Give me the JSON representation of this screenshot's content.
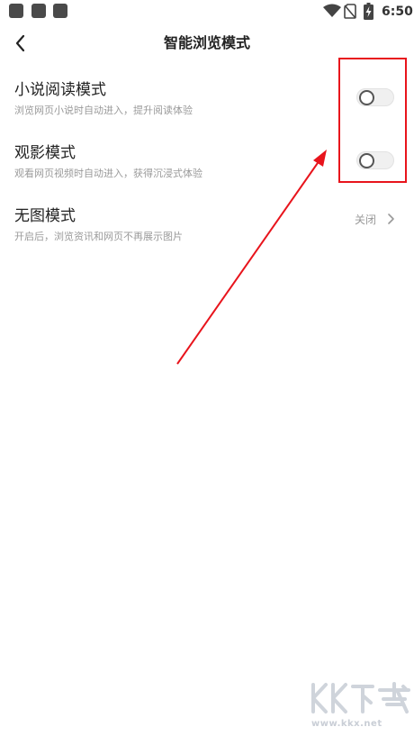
{
  "status_bar": {
    "time": "6:50",
    "icons": [
      "app-square-icon",
      "app-square-icon",
      "app-square-icon",
      "wifi-icon",
      "no-sim-icon",
      "battery-charging-icon"
    ]
  },
  "header": {
    "title": "智能浏览模式",
    "back_icon": "chevron-left-icon"
  },
  "settings": [
    {
      "title": "小说阅读模式",
      "description": "浏览网页小说时自动进入，提升阅读体验",
      "control": "toggle",
      "enabled": false
    },
    {
      "title": "观影模式",
      "description": "观看网页视频时自动进入，获得沉浸式体验",
      "control": "toggle",
      "enabled": false
    },
    {
      "title": "无图模式",
      "description": "开启后，浏览资讯和网页不再展示图片",
      "control": "value",
      "value": "关闭"
    }
  ],
  "annotation": {
    "color": "#e8141c"
  },
  "watermark": {
    "logo": "KK下载",
    "url": "www.kkx.net"
  },
  "colors": {
    "text": "#222222",
    "secondary": "#9a9a9a",
    "toggle_track": "#f0f0f0"
  }
}
